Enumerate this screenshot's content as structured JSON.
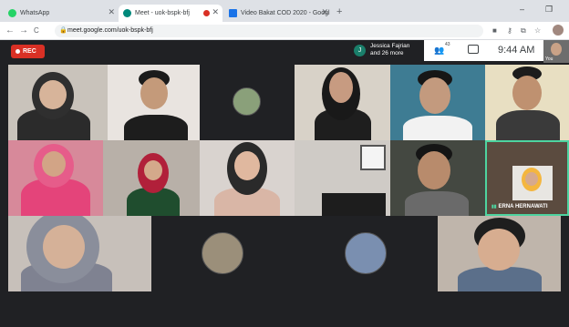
{
  "browser": {
    "tabs": [
      {
        "label": "WhatsApp",
        "favicon_color": "#25d366"
      },
      {
        "label": "Meet - uok-bspk-bfj",
        "favicon_color": "#00897b"
      },
      {
        "label": "Video Bakat COD 2020 - Googl",
        "favicon_color": "#1a73e8"
      }
    ],
    "new_tab": "+",
    "url": "meet.google.com/uok-bspk-bfj",
    "controls": {
      "minimize": "–",
      "restore": "❐"
    },
    "back": "←",
    "forward": "→",
    "reload": "C"
  },
  "meeting": {
    "rec_label": "REC",
    "participant_chip": {
      "initial": "J",
      "line1": "Jessica Fajrian",
      "line2": "and 26 more"
    },
    "people_count": "43",
    "time": "9:44 AM",
    "self_label": "You",
    "speaker_name": "ERNA HERNAWATI",
    "colors": {
      "rec": "#d93025",
      "bg": "#202124",
      "active": "#4ed4a0"
    }
  }
}
